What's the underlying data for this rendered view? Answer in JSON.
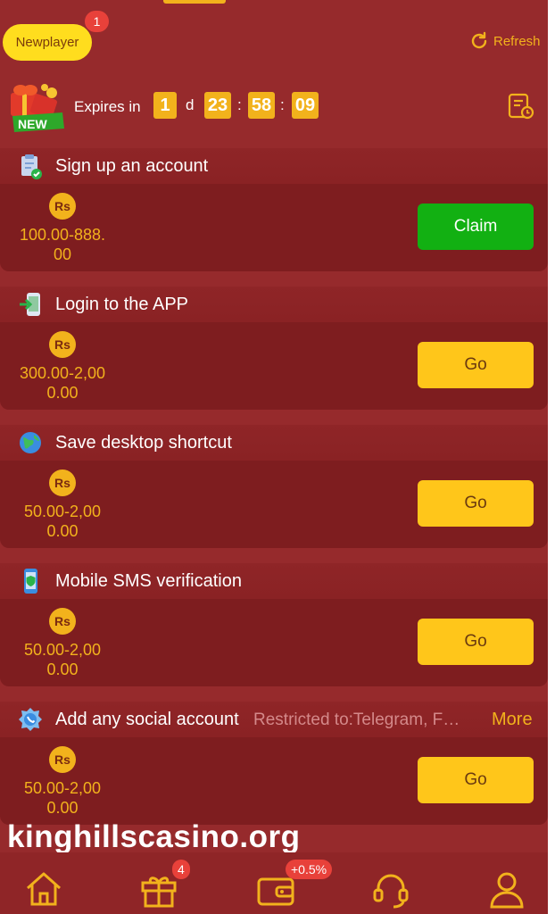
{
  "header": {
    "active_tab": "Newplayer",
    "tab_badge": "1",
    "refresh_label": "Refresh"
  },
  "expiry": {
    "badge_label": "NEW",
    "label": "Expires in",
    "days": "1",
    "days_unit": "d",
    "hours": "23",
    "minutes": "58",
    "seconds": "09",
    "separator": ":"
  },
  "tasks": [
    {
      "title": "Sign up an account",
      "currency": "Rs",
      "reward_line1": "100.00-888.",
      "reward_line2": "00",
      "button": "Claim",
      "icon": "clipboard-check-icon"
    },
    {
      "title": "Login to the APP",
      "currency": "Rs",
      "reward_line1": "300.00-2,00",
      "reward_line2": "0.00",
      "button": "Go",
      "icon": "phone-login-icon"
    },
    {
      "title": "Save desktop shortcut",
      "currency": "Rs",
      "reward_line1": "50.00-2,00",
      "reward_line2": "0.00",
      "button": "Go",
      "icon": "globe-icon"
    },
    {
      "title": "Mobile SMS verification",
      "currency": "Rs",
      "reward_line1": "50.00-2,00",
      "reward_line2": "0.00",
      "button": "Go",
      "icon": "phone-shield-icon"
    },
    {
      "title": "Add any social account",
      "restricted": "Restricted to:Telegram, F…",
      "more": "More",
      "currency": "Rs",
      "reward_line1": "50.00-2,00",
      "reward_line2": "0.00",
      "button": "Go",
      "icon": "social-bubble-icon"
    }
  ],
  "watermark": "kinghillscasino.org",
  "bottom_nav": {
    "gift_badge": "4",
    "wallet_badge": "+0.5%"
  },
  "colors": {
    "background": "#962a2c",
    "card": "#7e1d1f",
    "accent": "#f2b21c",
    "claim": "#12b012",
    "go": "#ffc61a"
  }
}
